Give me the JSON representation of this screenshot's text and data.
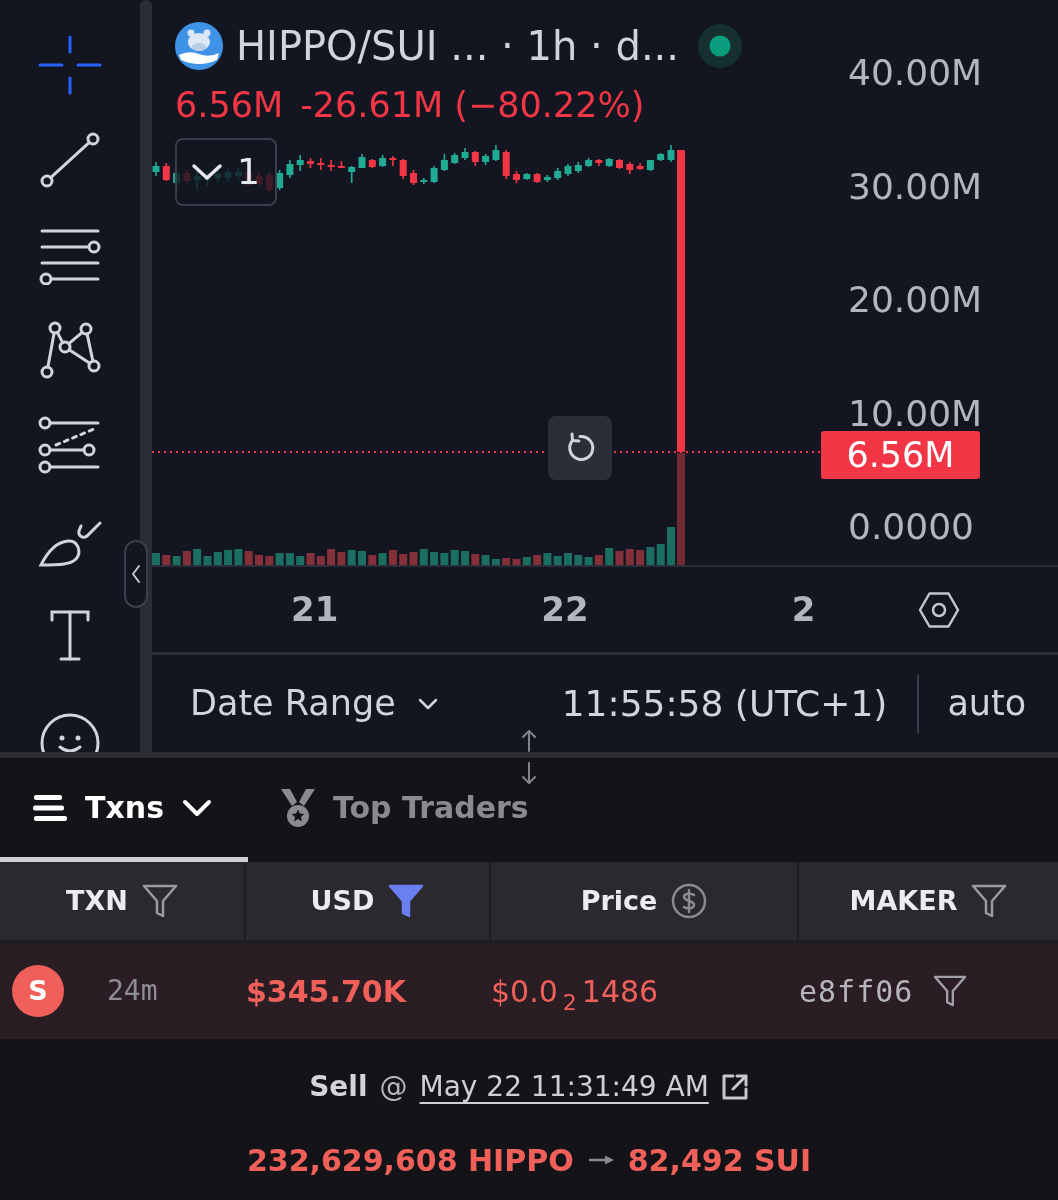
{
  "toolbar": {
    "tools": [
      {
        "kind": "crosshair",
        "selected": true
      },
      {
        "kind": "trend_line",
        "selected": false
      },
      {
        "kind": "horizontal_lines",
        "selected": false
      },
      {
        "kind": "pattern",
        "selected": false
      },
      {
        "kind": "projection",
        "selected": false
      },
      {
        "kind": "brush",
        "selected": false
      },
      {
        "kind": "text",
        "selected": false
      },
      {
        "kind": "emoji",
        "selected": false
      }
    ]
  },
  "chart": {
    "title": "HIPPO/SUI ... · 1h · d...",
    "last_value": "6.56M",
    "change": "-26.61M (−80.22%)",
    "indicator_count": "1",
    "y_axis": [
      "40.00M",
      "30.00M",
      "20.00M",
      "10.00M",
      "0.0000"
    ],
    "price_tag": "6.56M",
    "x_axis": [
      "21",
      "22",
      "2"
    ]
  },
  "bottom_bar": {
    "date_range": "Date Range",
    "clock": "11:55:58 (UTC+1)",
    "scale": "auto"
  },
  "tabs": [
    {
      "label": "Txns",
      "selected": true
    },
    {
      "label": "Top Traders",
      "selected": false
    }
  ],
  "table": {
    "columns": [
      {
        "label": "TXN",
        "kind": "filter",
        "filter_active": false
      },
      {
        "label": "USD",
        "kind": "filter",
        "filter_active": true
      },
      {
        "label": "Price",
        "kind": "currency"
      },
      {
        "label": "MAKER",
        "kind": "filter",
        "filter_active": false
      }
    ],
    "rows": [
      {
        "kind": "sell",
        "side": "S",
        "age": "24m",
        "usd": "$345.70K",
        "price": "$0.0$_{2}$1486",
        "maker": "e8ff06"
      }
    ]
  },
  "detail": {
    "kind": "sell",
    "side": "Sell",
    "at": "@",
    "time": "May 22 11:31:49 AM",
    "amount_in": "232,629,608 HIPPO",
    "amount_out": "82,492 SUI"
  }
}
